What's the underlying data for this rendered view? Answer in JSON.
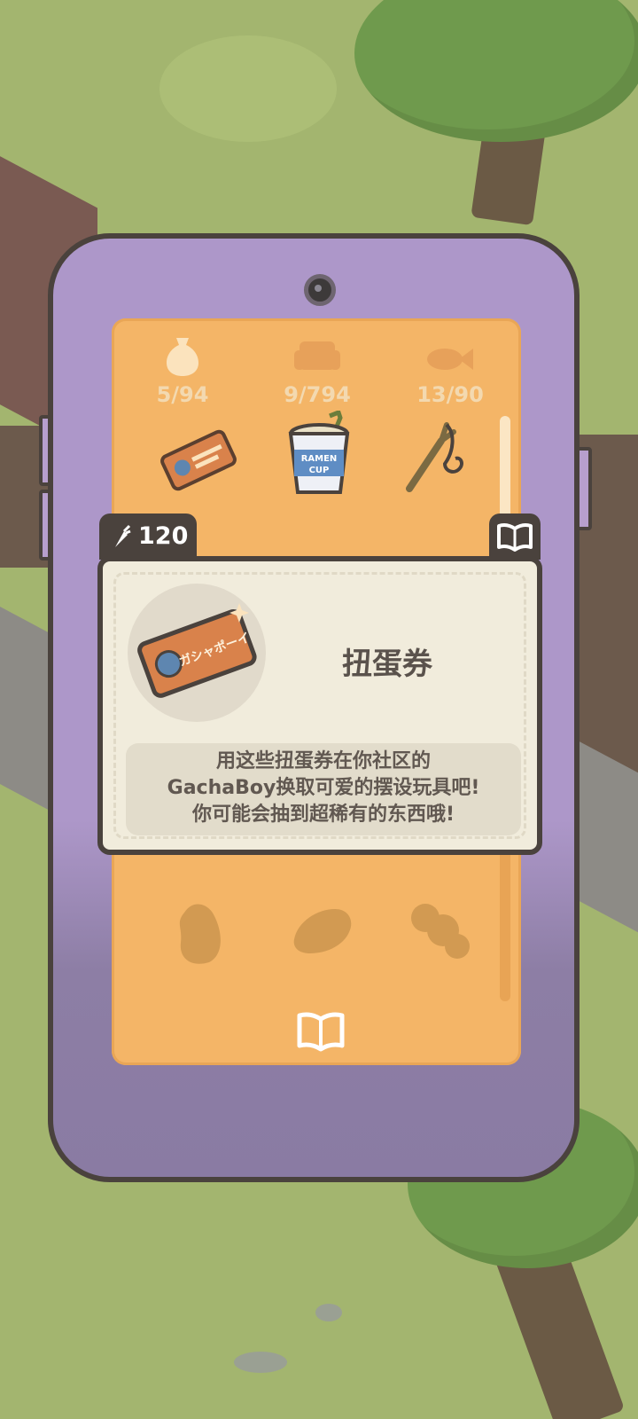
{
  "collection": {
    "stats": [
      {
        "icon": "sack-icon",
        "value": "5/94"
      },
      {
        "icon": "sofa-icon",
        "value": "9/794"
      },
      {
        "icon": "fish-icon",
        "value": "13/90"
      }
    ],
    "items_row1": [
      "gacha-ticket-icon",
      "ramen-cup-icon",
      "slingshot-icon"
    ],
    "ramen_label_1": "RAMEN",
    "ramen_label_2": "CUP",
    "items_locked": [
      "locked-item-icon",
      "locked-item-icon",
      "locked-item-icon"
    ]
  },
  "popup": {
    "carrot_count": "120",
    "item_name": "扭蛋券",
    "ticket_text": "ガシャポーイ",
    "description_lines": [
      "用这些扭蛋券在你社区的",
      "GachaBoy换取可爱的摆设玩具吧!",
      "你可能会抽到超稀有的东西哦!"
    ]
  },
  "colors": {
    "screen": "#f4b567",
    "phone": "#ad97c9",
    "popup": "#f1ecdc",
    "outline": "#4a423d"
  }
}
